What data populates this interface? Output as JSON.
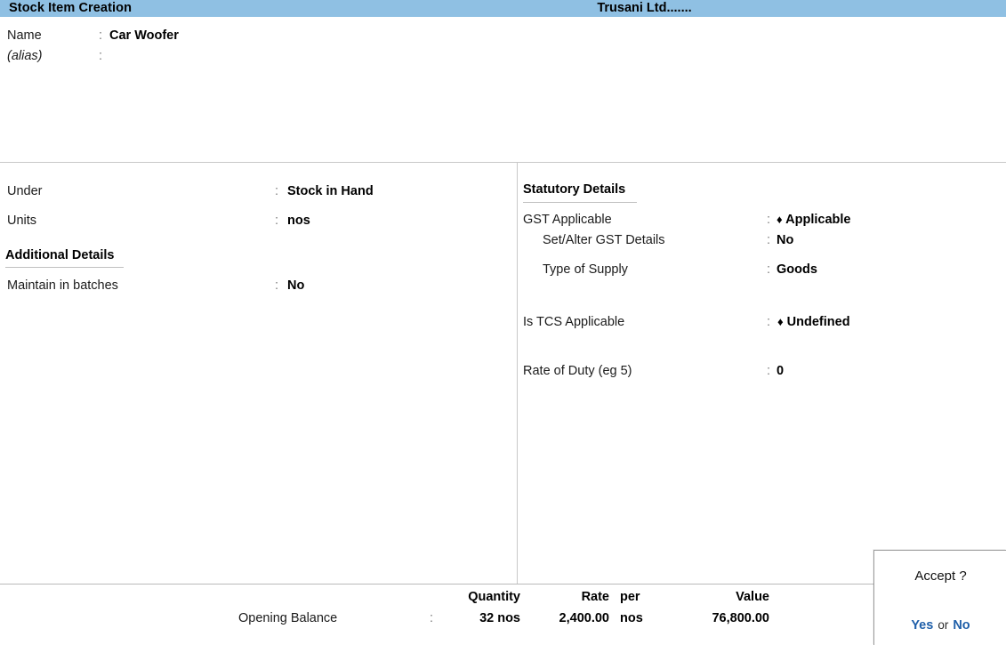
{
  "titlebar": {
    "screen_title": "Stock Item Creation",
    "company": "Trusani Ltd.......",
    "bg_color": "#8fc0e3"
  },
  "name_block": {
    "name_label": "Name",
    "name_colon": ":",
    "name_value": "Car Woofer",
    "alias_label": "(alias)",
    "alias_colon": ":",
    "alias_value": ""
  },
  "left_panel": {
    "rows": [
      {
        "label": "Under",
        "colon": ":",
        "value": "Stock in Hand"
      },
      {
        "label": "Units",
        "colon": ":",
        "value": "nos"
      }
    ],
    "section_heading": "Additional Details",
    "extra_rows": [
      {
        "label": "Maintain in batches",
        "colon": ":",
        "value": "No"
      }
    ]
  },
  "right_panel": {
    "section_heading": "Statutory Details",
    "rows": [
      {
        "label": "GST Applicable",
        "colon": ":",
        "marker": "♦",
        "value": "Applicable"
      },
      {
        "label": "Set/Alter GST Details",
        "colon": ":",
        "marker": "",
        "value": "No"
      },
      {
        "label": "Type of Supply",
        "colon": ":",
        "marker": "",
        "value": "Goods"
      },
      {
        "label": "Is TCS Applicable",
        "colon": ":",
        "marker": "♦",
        "value": "Undefined"
      },
      {
        "label": "Rate of Duty (eg 5)",
        "colon": ":",
        "marker": "",
        "value": "0"
      }
    ]
  },
  "bottom_bar": {
    "headers": {
      "quantity": "Quantity",
      "rate": "Rate",
      "per": "per",
      "value": "Value"
    },
    "opening_balance": {
      "label": "Opening Balance",
      "colon": ":",
      "quantity": "32 nos",
      "rate": "2,400.00",
      "per": "nos",
      "value": "76,800.00"
    }
  },
  "accept_dialog": {
    "title": "Accept ?",
    "yes": "Yes",
    "or": "or",
    "no": "No",
    "link_color": "#1f5fa9"
  }
}
